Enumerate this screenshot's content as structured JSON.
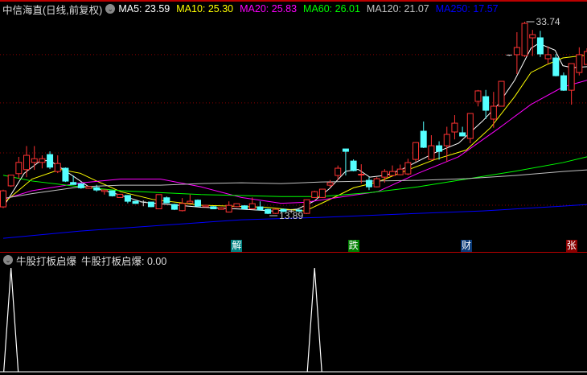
{
  "header": {
    "title": "中信海直(日线,前复权)",
    "icon": "chevron-down-circle-icon",
    "ma": [
      {
        "label": "MA5: 23.59",
        "color": "#ffffff"
      },
      {
        "label": "MA10: 25.30",
        "color": "#ffff00"
      },
      {
        "label": "MA20: 25.83",
        "color": "#ff00ff"
      },
      {
        "label": "MA60: 26.01",
        "color": "#00ff00"
      },
      {
        "label": "MA120: 21.07",
        "color": "#c0c0c0"
      },
      {
        "label": "MA250: 17.57",
        "color": "#0000ff"
      }
    ]
  },
  "signals": [
    {
      "text": "解",
      "bg": "#008080",
      "idx": 30
    },
    {
      "text": "跌",
      "bg": "#008000",
      "idx": 45
    },
    {
      "text": "财",
      "bg": "#0a3a78",
      "idx": 59.5
    },
    {
      "text": "张",
      "bg": "#8b0000",
      "idx": 73
    }
  ],
  "indicator": {
    "name": "牛股打板启爆",
    "value_label": "牛股打板启爆: 0.00"
  },
  "chart_data": {
    "type": "candlestick",
    "price_range": [
      11.0,
      34.3
    ],
    "grid_levels": [
      30.34,
      25.36,
      20.2,
      14.8
    ],
    "annotations": [
      {
        "text": "33.74",
        "idx": 67,
        "price": 33.74
      },
      {
        "text": "13.89",
        "idx": 34,
        "price": 13.89
      }
    ],
    "up_color": "#ff3232",
    "down_color": "#54ffff",
    "doji_color": "#dddddd",
    "candles": [
      [
        14.63,
        16.4,
        14.5,
        16.29
      ],
      [
        16.8,
        17.9,
        16.7,
        17.91
      ],
      [
        18.06,
        19.79,
        17.56,
        19.22
      ],
      [
        18.48,
        20.91,
        17.7,
        19.95
      ],
      [
        19.22,
        20.91,
        18.45,
        19.6
      ],
      [
        19.22,
        19.95,
        18.6,
        19.6
      ],
      [
        20.03,
        20.36,
        18.53,
        18.73
      ],
      [
        18.28,
        19.95,
        18.12,
        19.11
      ],
      [
        18.62,
        18.7,
        17.2,
        17.29
      ],
      [
        17.15,
        17.87,
        16.9,
        16.94
      ],
      [
        17.0,
        17.1,
        16.5,
        16.6
      ],
      [
        16.54,
        16.8,
        16.5,
        16.73
      ],
      [
        16.62,
        16.9,
        16.2,
        16.37
      ],
      [
        16.23,
        16.4,
        15.9,
        16.37
      ],
      [
        16.29,
        16.3,
        15.7,
        15.77
      ],
      [
        15.6,
        15.95,
        15.55,
        15.93
      ],
      [
        15.81,
        15.85,
        15.0,
        15.21
      ],
      [
        15.21,
        15.25,
        14.95,
        14.99
      ],
      [
        15.13,
        15.3,
        14.7,
        15.13
      ],
      [
        15.13,
        15.15,
        14.6,
        14.65
      ],
      [
        14.43,
        15.9,
        14.4,
        15.9
      ],
      [
        15.57,
        15.7,
        15.0,
        15.05
      ],
      [
        14.88,
        14.95,
        14.3,
        14.38
      ],
      [
        14.24,
        15.54,
        14.16,
        14.99
      ],
      [
        15.02,
        15.9,
        15.0,
        15.21
      ],
      [
        15.32,
        15.4,
        14.65,
        14.71
      ],
      [
        14.65,
        14.85,
        14.6,
        14.79
      ],
      [
        14.65,
        14.7,
        14.4,
        14.43
      ],
      [
        14.38,
        14.6,
        14.35,
        14.54
      ],
      [
        14.1,
        15.2,
        14.05,
        14.79
      ],
      [
        14.65,
        15.0,
        14.6,
        14.96
      ],
      [
        14.74,
        14.8,
        14.4,
        14.43
      ],
      [
        14.43,
        15.6,
        14.4,
        14.96
      ],
      [
        14.63,
        15.2,
        14.3,
        14.32
      ],
      [
        14.38,
        14.45,
        13.89,
        13.96
      ],
      [
        13.96,
        14.45,
        13.9,
        14.38
      ],
      [
        14.38,
        14.45,
        14.1,
        14.16
      ],
      [
        14.2,
        14.4,
        14.0,
        14.2
      ],
      [
        14.3,
        14.4,
        14.1,
        14.2
      ],
      [
        13.96,
        15.4,
        13.9,
        15.37
      ],
      [
        15.6,
        16.3,
        15.55,
        16.2
      ],
      [
        15.6,
        16.5,
        15.55,
        16.46
      ],
      [
        16.87,
        17.4,
        16.6,
        17.12
      ],
      [
        17.87,
        18.9,
        17.4,
        18.62
      ],
      [
        20.61,
        20.61,
        17.87,
        20.36
      ],
      [
        19.36,
        19.53,
        18.3,
        18.37
      ],
      [
        17.95,
        19.03,
        17.04,
        18.0
      ],
      [
        17.37,
        17.7,
        16.37,
        16.7
      ],
      [
        16.7,
        17.7,
        16.65,
        17.54
      ],
      [
        17.7,
        18.53,
        17.12,
        18.28
      ],
      [
        17.87,
        18.9,
        17.8,
        18.28
      ],
      [
        17.95,
        19.0,
        17.9,
        18.53
      ],
      [
        18.03,
        19.6,
        17.9,
        19.2
      ],
      [
        19.53,
        21.3,
        19.3,
        21.27
      ],
      [
        22.44,
        23.44,
        20.7,
        20.78
      ],
      [
        19.53,
        22.03,
        19.5,
        20.94
      ],
      [
        20.94,
        21.4,
        19.5,
        20.36
      ],
      [
        20.94,
        22.9,
        19.28,
        22.11
      ],
      [
        22.36,
        24.1,
        21.6,
        23.27
      ],
      [
        22.28,
        22.9,
        21.9,
        21.95
      ],
      [
        21.69,
        24.3,
        21.2,
        24.27
      ],
      [
        25.52,
        26.7,
        25.0,
        26.6
      ],
      [
        26.01,
        26.7,
        23.7,
        24.6
      ],
      [
        23.69,
        26.5,
        22.8,
        25.02
      ],
      [
        25.02,
        27.6,
        25.0,
        27.59
      ],
      [
        30.3,
        30.34,
        30.2,
        30.3
      ],
      [
        30.34,
        32.66,
        28.34,
        31.08
      ],
      [
        30.25,
        33.74,
        30.1,
        33.57
      ],
      [
        32.08,
        32.9,
        30.2,
        32.41
      ],
      [
        32.08,
        32.8,
        30.1,
        30.42
      ],
      [
        29.92,
        31.2,
        29.4,
        30.34
      ],
      [
        30.0,
        30.4,
        28.1,
        28.17
      ],
      [
        28.17,
        28.5,
        26.6,
        26.67
      ],
      [
        26.67,
        29.45,
        25.18,
        29.42
      ],
      [
        28.5,
        31.1,
        28.2,
        30.34
      ],
      [
        29.33,
        31.0,
        29.3,
        30.67
      ]
    ],
    "ma_series": [
      {
        "name": "MA5",
        "color": "#ffffff",
        "points": [
          [
            0,
            14.6
          ],
          [
            2.7,
            18.1
          ],
          [
            4.8,
            19.4
          ],
          [
            6,
            19.4
          ],
          [
            7.9,
            18.4
          ],
          [
            11,
            16.7
          ],
          [
            14,
            16.1
          ],
          [
            18,
            15.1
          ],
          [
            25.4,
            14.6
          ],
          [
            30.6,
            14.4
          ],
          [
            34.7,
            14.2
          ],
          [
            37.8,
            14.4
          ],
          [
            39.9,
            15.2
          ],
          [
            41.9,
            16.5
          ],
          [
            44,
            18.3
          ],
          [
            45.6,
            18.5
          ],
          [
            47.1,
            17.7
          ],
          [
            49.2,
            17.9
          ],
          [
            51.2,
            18.5
          ],
          [
            55.4,
            20.2
          ],
          [
            58.5,
            21.2
          ],
          [
            61.6,
            23.5
          ],
          [
            63.6,
            25.2
          ],
          [
            65.7,
            27.7
          ],
          [
            67.8,
            31.0
          ],
          [
            68.8,
            31.5
          ],
          [
            70.9,
            30.8
          ],
          [
            71.9,
            29.2
          ],
          [
            73.1,
            29.0
          ],
          [
            75,
            29.1
          ]
        ]
      },
      {
        "name": "MA10",
        "color": "#ffff00",
        "points": [
          [
            0,
            15.0
          ],
          [
            3.7,
            17.5
          ],
          [
            7.3,
            18.5
          ],
          [
            9.9,
            18.1
          ],
          [
            12,
            17.3
          ],
          [
            15.1,
            16.2
          ],
          [
            19.2,
            15.4
          ],
          [
            25.4,
            14.8
          ],
          [
            33.7,
            14.6
          ],
          [
            38.8,
            14.2
          ],
          [
            40.9,
            15.0
          ],
          [
            43,
            15.8
          ],
          [
            45,
            16.6
          ],
          [
            48.1,
            17.2
          ],
          [
            51.2,
            18.2
          ],
          [
            55.4,
            19.5
          ],
          [
            59.5,
            20.5
          ],
          [
            62.6,
            22.8
          ],
          [
            65.7,
            26.0
          ],
          [
            67.8,
            28.5
          ],
          [
            69.8,
            29.3
          ],
          [
            71.9,
            30.0
          ],
          [
            75,
            30.3
          ]
        ]
      },
      {
        "name": "MA20",
        "color": "#ff00ff",
        "points": [
          [
            0,
            15.4
          ],
          [
            3.7,
            16.3
          ],
          [
            9.9,
            17.1
          ],
          [
            15.1,
            17.5
          ],
          [
            20.2,
            17.5
          ],
          [
            25.4,
            16.7
          ],
          [
            30.6,
            15.6
          ],
          [
            35.7,
            15.0
          ],
          [
            38.8,
            15.1
          ],
          [
            43,
            15.6
          ],
          [
            48.1,
            16.2
          ],
          [
            53.3,
            18.1
          ],
          [
            58.5,
            19.8
          ],
          [
            63.6,
            22.7
          ],
          [
            67.8,
            25.2
          ],
          [
            71.9,
            27.0
          ],
          [
            75,
            27.7
          ]
        ]
      },
      {
        "name": "MA60",
        "color": "#00ff00",
        "points": [
          [
            0,
            17.9
          ],
          [
            3.7,
            17.3
          ],
          [
            9.9,
            16.7
          ],
          [
            15.1,
            16.3
          ],
          [
            20.2,
            16.1
          ],
          [
            25.4,
            15.9
          ],
          [
            30.6,
            15.8
          ],
          [
            35.7,
            15.7
          ],
          [
            40.9,
            15.7
          ],
          [
            47.1,
            16.1
          ],
          [
            53.3,
            16.7
          ],
          [
            59.5,
            17.5
          ],
          [
            65.7,
            18.3
          ],
          [
            71.9,
            19.2
          ],
          [
            75,
            19.8
          ]
        ]
      },
      {
        "name": "MA120",
        "color": "#c0c0c0",
        "points": [
          [
            0,
            15.5
          ],
          [
            3.7,
            16.0
          ],
          [
            9.9,
            16.7
          ],
          [
            15.1,
            16.87
          ],
          [
            20.2,
            16.87
          ],
          [
            25.4,
            17.04
          ],
          [
            30.6,
            17.12
          ],
          [
            35.7,
            17.04
          ],
          [
            40.9,
            17.2
          ],
          [
            47.1,
            17.29
          ],
          [
            53.3,
            17.37
          ],
          [
            59.5,
            17.54
          ],
          [
            65.7,
            17.87
          ],
          [
            71.9,
            18.28
          ],
          [
            75,
            18.45
          ]
        ]
      },
      {
        "name": "MA250",
        "color": "#0000ff",
        "points": [
          [
            0,
            11.39
          ],
          [
            9.9,
            12.13
          ],
          [
            20.2,
            12.72
          ],
          [
            30.6,
            13.3
          ],
          [
            40.9,
            13.55
          ],
          [
            51.2,
            13.89
          ],
          [
            61.6,
            14.21
          ],
          [
            71.9,
            14.71
          ],
          [
            75,
            14.88
          ]
        ]
      }
    ],
    "indicator_series": {
      "range": [
        0,
        1
      ],
      "spikes": [
        1,
        40
      ]
    }
  }
}
